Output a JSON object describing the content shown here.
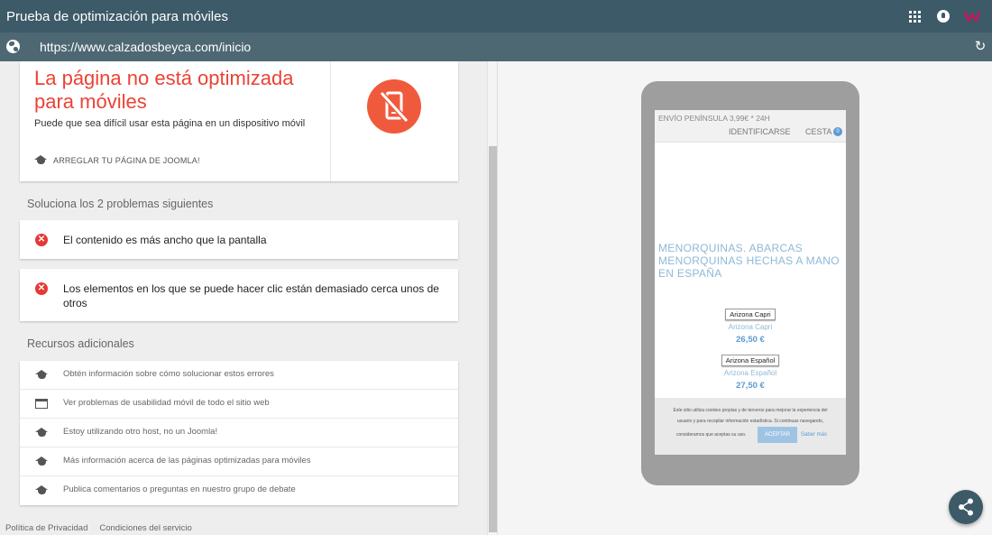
{
  "app": {
    "title": "Prueba de optimización para móviles"
  },
  "urlbar": {
    "url": "https://www.calzadosbeyca.com/inicio"
  },
  "result": {
    "title": "La página no está optimizada para móviles",
    "subtitle": "Puede que sea difícil usar esta página en un dispositivo móvil",
    "fix_link": "ARREGLAR TU PÁGINA DE JOOMLA!"
  },
  "issues": {
    "heading": "Soluciona los 2 problemas siguientes",
    "items": [
      {
        "text": "El contenido es más ancho que la pantalla"
      },
      {
        "text": "Los elementos en los que se puede hacer clic están demasiado cerca unos de otros"
      }
    ]
  },
  "resources": {
    "heading": "Recursos adicionales",
    "items": [
      {
        "text": "Obtén información sobre cómo solucionar estos errores",
        "icon": "graduation-cap-icon"
      },
      {
        "text": "Ver problemas de usabilidad móvil de todo el sitio web",
        "icon": "browser-window-icon"
      },
      {
        "text": "Estoy utilizando otro host, no un Joomla!",
        "icon": "graduation-cap-icon"
      },
      {
        "text": "Más información acerca de las páginas optimizadas para móviles",
        "icon": "graduation-cap-icon"
      },
      {
        "text": "Publica comentarios o preguntas en nuestro grupo de debate",
        "icon": "graduation-cap-icon"
      }
    ]
  },
  "footer": {
    "privacy": "Política de Privacidad",
    "terms": "Condiciones del servicio"
  },
  "preview": {
    "shipping": "ENVÍO PENÍNSULA 3,99€ * 24H",
    "login": "IDENTIFICARSE",
    "cart": "CESTA",
    "cart_count": "0",
    "hero": "MENORQUINAS. ABARCAS MENORQUINAS HECHAS A MANO EN ESPAÑA",
    "products": [
      {
        "thumb": "Arizona Capri",
        "name": "Arizona Capri",
        "price": "26,50 €"
      },
      {
        "thumb": "Arizona Español",
        "name": "Arizona Español",
        "price": "27,50 €"
      }
    ],
    "cookie": {
      "line1": "Este sitio utiliza cookies propias y de terceros para mejorar la experiencia del",
      "line2": "usuario y para recopilar información estadística. Si continuas navegando,",
      "line3": "consideramos que aceptas su uso.",
      "accept": "ACEPTAR",
      "more": "Saber más"
    }
  },
  "colors": {
    "header": "#3c5a67",
    "urlbar": "#4e6873",
    "error": "#ea4335",
    "link_blue": "#5b9bd5"
  }
}
